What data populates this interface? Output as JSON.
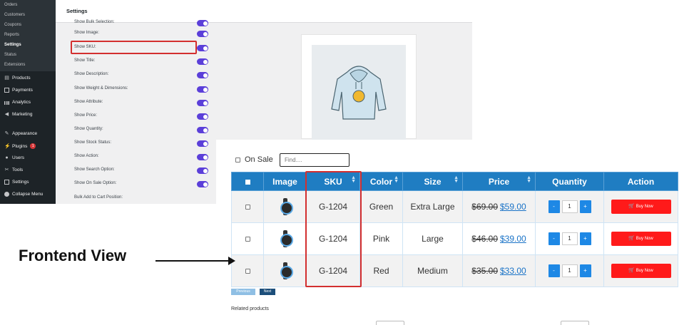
{
  "wp_sidebar": {
    "submenu": [
      "Orders",
      "Customers",
      "Coupons",
      "Reports",
      "Settings",
      "Status",
      "Extensions"
    ],
    "active_submenu": "Settings",
    "menu": [
      {
        "label": "Products",
        "icon": "products-icon"
      },
      {
        "label": "Payments",
        "icon": "payments-icon"
      },
      {
        "label": "Analytics",
        "icon": "analytics-icon"
      },
      {
        "label": "Marketing",
        "icon": "marketing-icon"
      },
      {
        "label": "Appearance",
        "icon": "appearance-icon"
      },
      {
        "label": "Plugins",
        "icon": "plugins-icon",
        "badge": "1"
      },
      {
        "label": "Users",
        "icon": "users-icon"
      },
      {
        "label": "Tools",
        "icon": "tools-icon"
      },
      {
        "label": "Settings",
        "icon": "settings-icon"
      },
      {
        "label": "Collapse Menu",
        "icon": "collapse-icon"
      }
    ]
  },
  "admin": {
    "title": "Settings",
    "settings": [
      {
        "label": "Show Bulk Selection:",
        "on": true
      },
      {
        "label": "Show Image:",
        "on": true
      },
      {
        "label": "Show SKU:",
        "on": true
      },
      {
        "label": "Show Title:",
        "on": true
      },
      {
        "label": "Show Description:",
        "on": true
      },
      {
        "label": "Show Weight & Dimensions:",
        "on": true
      },
      {
        "label": "Show Attribute:",
        "on": true
      },
      {
        "label": "Show Price:",
        "on": true
      },
      {
        "label": "Show Quantity:",
        "on": true
      },
      {
        "label": "Show Stock Status:",
        "on": true
      },
      {
        "label": "Show Action:",
        "on": true
      },
      {
        "label": "Show Search Option:",
        "on": true
      },
      {
        "label": "Show On Sale Option:",
        "on": true
      },
      {
        "label": "Bulk Add to Cart Position:",
        "on": null
      }
    ],
    "toggle_color": "#5b3fd9",
    "preview_image": "hoodie-product-image"
  },
  "frontend": {
    "on_sale_label": "On Sale",
    "find_placeholder": "Find....",
    "columns": [
      "",
      "Image",
      "SKU",
      "Color",
      "Size",
      "Price",
      "Quantity",
      "Action"
    ],
    "rows": [
      {
        "sku": "G-1204",
        "color": "Green",
        "size": "Extra Large",
        "price_old": "$69.00",
        "price_new": "$59.00",
        "qty": "1",
        "action": "Buy Now"
      },
      {
        "sku": "G-1204",
        "color": "Pink",
        "size": "Large",
        "price_old": "$46.00",
        "price_new": "$39.00",
        "qty": "1",
        "action": "Buy Now"
      },
      {
        "sku": "G-1204",
        "color": "Red",
        "size": "Medium",
        "price_old": "$35.00",
        "price_new": "$33.00",
        "qty": "1",
        "action": "Buy Now"
      }
    ],
    "qty_minus": "-",
    "qty_plus": "+",
    "pagination": {
      "prev": "Previous",
      "next": "Next"
    },
    "related_label": "Related products",
    "header_color": "#1f7dc2",
    "buy_color": "#ff1a1a"
  },
  "annotation": {
    "label": "Frontend View",
    "highlight_color": "#d32f2f"
  }
}
